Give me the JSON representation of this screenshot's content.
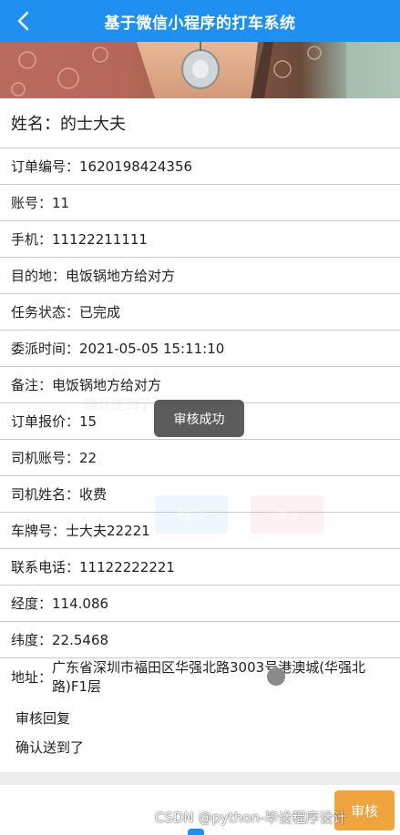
{
  "colors": {
    "navbar": "#1f8ff0",
    "review_button": "#f0a43c",
    "toast_bg": "#464646"
  },
  "header": {
    "back_icon": "chevron-left-icon",
    "title": "基于微信小程序的打车系统"
  },
  "detail": {
    "name": "姓名：的士大夫",
    "order_no": "订单编号：1620198424356",
    "account": "账号：11",
    "phone": "手机：11122211111",
    "destination": "目的地：电饭锅地方给对方",
    "task_status": "任务状态：已完成",
    "assign_time": "委派时间：2021-05-05 15:11:10",
    "remark": "备注：电饭锅地方给对方",
    "price": "订单报价：15",
    "driver_account": "司机账号：22",
    "driver_name": "司机姓名：收费",
    "plate": "车牌号：士大夫22221",
    "contact_phone": "联系电话：11122222221",
    "longitude": "经度：114.086",
    "latitude": "纬度：22.5468",
    "address_label": "地址：",
    "address_value": "广东省深圳市福田区华强北路3003号港澳城(华强北路)F1层"
  },
  "review": {
    "title": "审核回复",
    "text": "确认送到了"
  },
  "ghost": {
    "reply": "确认送到了",
    "cancel": "取消",
    "confirm": "确认"
  },
  "toast": "审核成功",
  "bottom_button": "审核",
  "watermark": "CSDN @python-毕设程序设计"
}
